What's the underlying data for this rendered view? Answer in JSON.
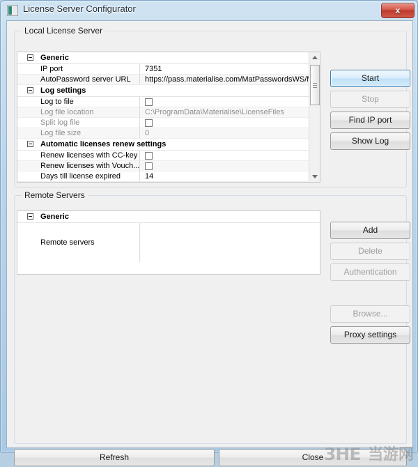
{
  "window": {
    "title": "License Server Configurator",
    "icon": "app-icon",
    "close_label": "x"
  },
  "local_server": {
    "group_title": "Local License Server",
    "grid": [
      {
        "type": "category",
        "label": "Generic"
      },
      {
        "type": "row",
        "name": "IP port",
        "value": "7351",
        "control": "text",
        "disabled": false
      },
      {
        "type": "row",
        "name": "AutoPassword server URL",
        "value": "https://pass.materialise.com/MatPasswordsWS/M",
        "control": "text",
        "disabled": false
      },
      {
        "type": "category",
        "label": "Log settings"
      },
      {
        "type": "row",
        "name": "Log to file",
        "value": "",
        "control": "checkbox",
        "checked": false,
        "disabled": false
      },
      {
        "type": "row",
        "name": "Log file location",
        "value": "C:\\ProgramData\\Materialise\\LicenseFiles",
        "control": "text",
        "disabled": true
      },
      {
        "type": "row",
        "name": "Split log file",
        "value": "",
        "control": "checkbox",
        "checked": false,
        "disabled": true
      },
      {
        "type": "row",
        "name": "Log file size",
        "value": "0",
        "control": "text",
        "disabled": true
      },
      {
        "type": "category",
        "label": "Automatic licenses renew settings"
      },
      {
        "type": "row",
        "name": "Renew licenses with CC-key",
        "value": "",
        "control": "checkbox",
        "checked": false,
        "disabled": false
      },
      {
        "type": "row",
        "name": "Renew licenses with Vouch...",
        "value": "",
        "control": "checkbox",
        "checked": false,
        "disabled": false
      },
      {
        "type": "row",
        "name": "Days till license expired",
        "value": "14",
        "control": "text",
        "disabled": false
      }
    ],
    "buttons": {
      "start": "Start",
      "stop": "Stop",
      "find_ip_port": "Find IP port",
      "show_log": "Show Log"
    }
  },
  "remote_servers": {
    "group_title": "Remote Servers",
    "grid": [
      {
        "type": "category",
        "label": "Generic"
      },
      {
        "type": "row_tall",
        "name": "Remote servers",
        "value": ""
      }
    ],
    "buttons": {
      "add": "Add",
      "delete": "Delete",
      "authentication": "Authentication",
      "browse": "Browse...",
      "proxy_settings": "Proxy settings"
    }
  },
  "footer": {
    "refresh": "Refresh",
    "close": "Close"
  },
  "watermark": {
    "latin": "3HE",
    "cjk": "当游网"
  }
}
